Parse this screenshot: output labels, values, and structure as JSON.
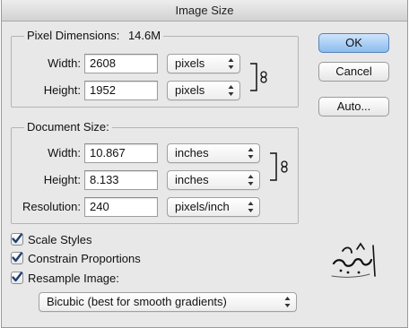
{
  "window": {
    "title": "Image Size"
  },
  "pixel_dimensions": {
    "title": "Pixel Dimensions:",
    "size": "14.6M",
    "width": {
      "label": "Width:",
      "value": "2608",
      "unit": "pixels"
    },
    "height": {
      "label": "Height:",
      "value": "1952",
      "unit": "pixels"
    }
  },
  "document_size": {
    "title": "Document Size:",
    "width": {
      "label": "Width:",
      "value": "10.867",
      "unit": "inches"
    },
    "height": {
      "label": "Height:",
      "value": "8.133",
      "unit": "inches"
    },
    "resolution": {
      "label": "Resolution:",
      "value": "240",
      "unit": "pixels/inch"
    }
  },
  "options": {
    "scale_styles": {
      "label": "Scale Styles",
      "checked": true
    },
    "constrain_proportions": {
      "label": "Constrain Proportions",
      "checked": true
    },
    "resample_image": {
      "label": "Resample Image:",
      "checked": true
    },
    "resample_method": "Bicubic (best for smooth gradients)"
  },
  "buttons": {
    "ok": "OK",
    "cancel": "Cancel",
    "auto": "Auto..."
  },
  "colors": {
    "window_bg": "#e8e8e8",
    "default_button": "#8bbcef",
    "checkmark": "#1f3f73"
  },
  "icons": {
    "link": "chain-link-icon",
    "stepper": "up-down-arrows-icon",
    "watermark": "calligraphy-logo"
  }
}
